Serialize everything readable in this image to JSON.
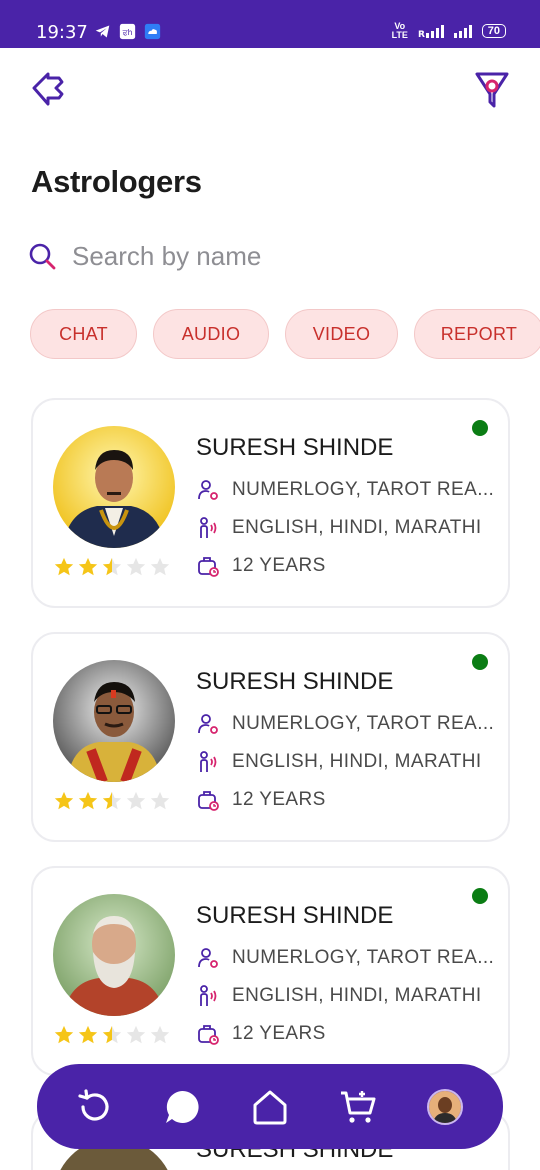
{
  "status_bar": {
    "time": "19:37",
    "network": "Vo LTE",
    "battery": "70"
  },
  "header": {
    "title": "Astrologers"
  },
  "search": {
    "placeholder": "Search by name"
  },
  "filters": [
    {
      "label": "CHAT"
    },
    {
      "label": "AUDIO"
    },
    {
      "label": "VIDEO"
    },
    {
      "label": "REPORT"
    }
  ],
  "astrologers": [
    {
      "name": "SURESH SHINDE",
      "skills": "NUMERLOGY, TAROT REA...",
      "languages": "ENGLISH, HINDI, MARATHI",
      "experience": "12 YEARS",
      "rating": 2.5,
      "online": true
    },
    {
      "name": "SURESH SHINDE",
      "skills": "NUMERLOGY, TAROT REA...",
      "languages": "ENGLISH, HINDI, MARATHI",
      "experience": "12 YEARS",
      "rating": 2.5,
      "online": true
    },
    {
      "name": "SURESH SHINDE",
      "skills": "NUMERLOGY, TAROT REA...",
      "languages": "ENGLISH, HINDI, MARATHI",
      "experience": "12 YEARS",
      "rating": 2.5,
      "online": true
    },
    {
      "name": "SURESH SHINDE"
    }
  ],
  "bottom_nav": [
    {
      "icon": "history-icon"
    },
    {
      "icon": "chat-icon"
    },
    {
      "icon": "home-icon"
    },
    {
      "icon": "cart-icon"
    },
    {
      "icon": "profile-avatar"
    }
  ],
  "colors": {
    "primary": "#4a23a8",
    "chip_bg": "#fde3e3",
    "chip_text": "#c8302c",
    "online": "#0b7d14",
    "star": "#f5c518"
  }
}
